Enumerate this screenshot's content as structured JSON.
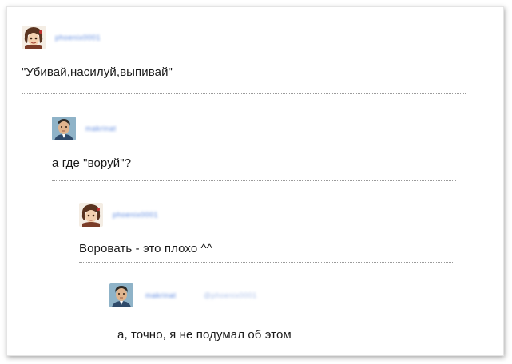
{
  "thread": [
    {
      "username": "phoenix0001",
      "text": "\"Убивай,насилуй,выпивай\""
    },
    {
      "username": "makrinat",
      "text": "а где \"воруй\"?"
    },
    {
      "username": "phoenix0001",
      "text": "Воровать - это плохо ^^"
    },
    {
      "username": "makrinat",
      "reply_to": "@phoenix0001",
      "text": "а, точно, я не подумал об этом"
    }
  ],
  "colors": {
    "username": "#3a6fd9",
    "text": "#1a1a1a",
    "divider": "#9a9a9a"
  },
  "icons": {
    "anime_avatar": "anime-character-avatar-icon",
    "man_avatar": "man-portrait-avatar-icon"
  }
}
